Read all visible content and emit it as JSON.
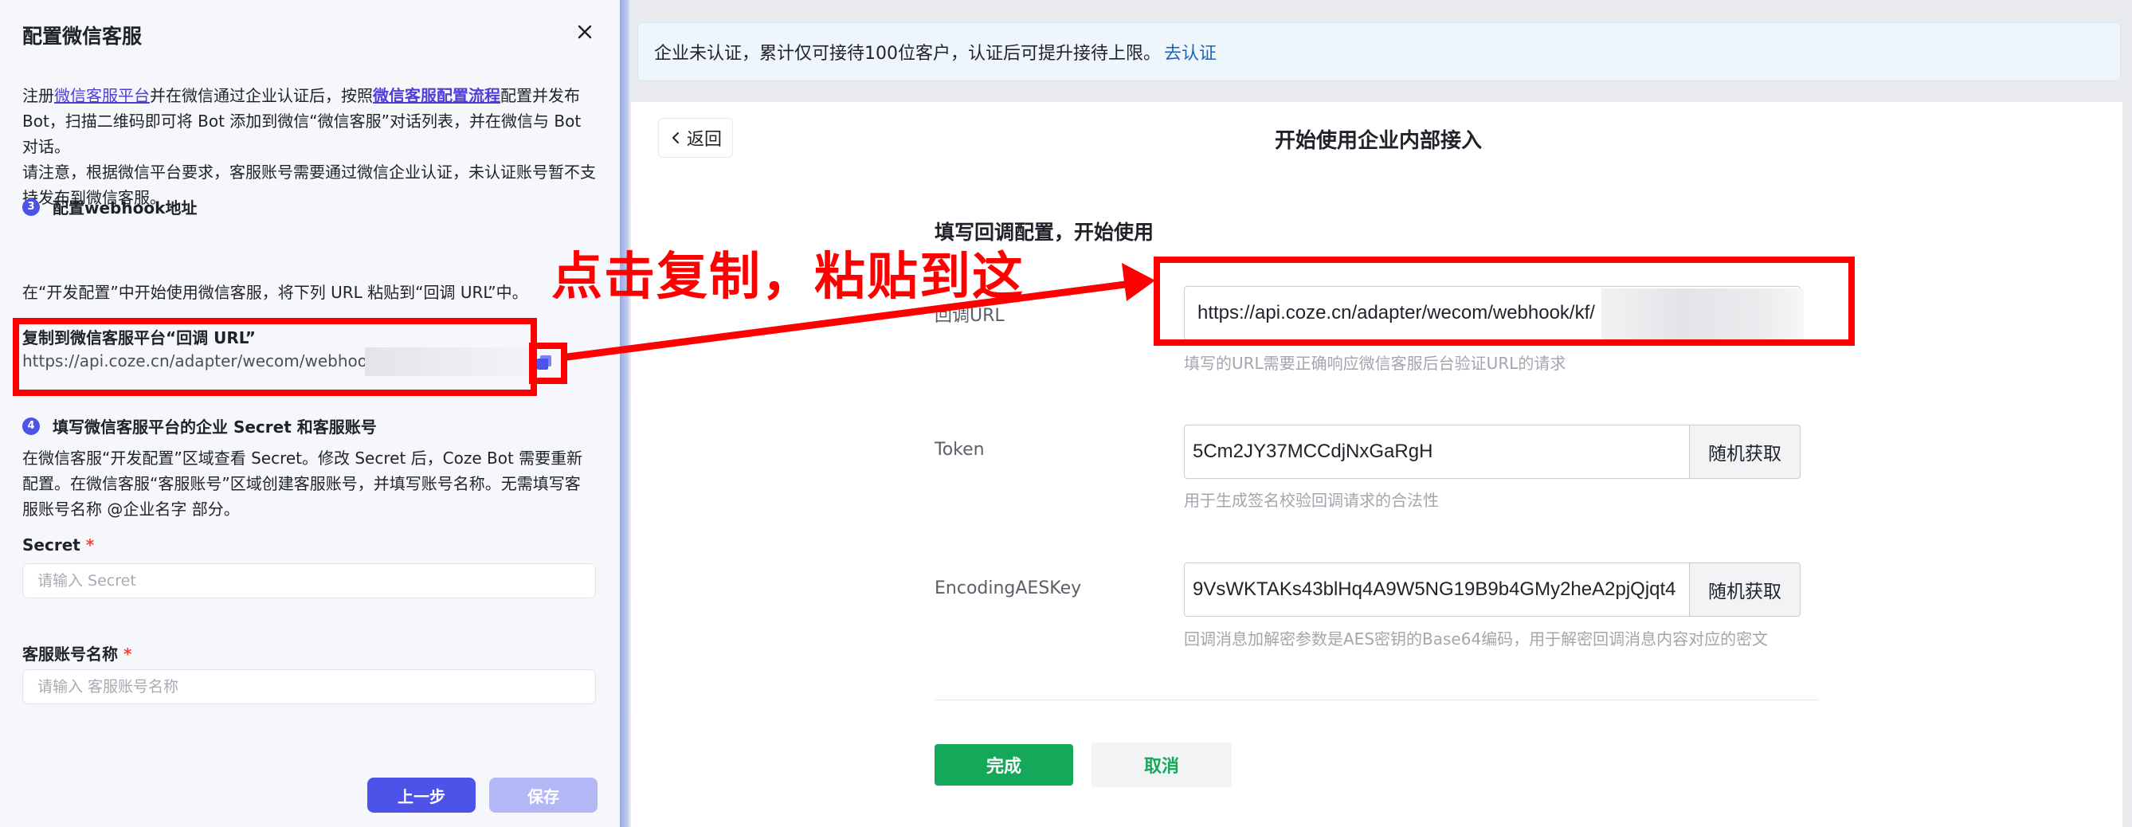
{
  "left_panel": {
    "title": "配置微信客服",
    "intro": {
      "p1_a": "注册",
      "p1_link1": "微信客服平台",
      "p1_b": "并在微信通过企业认证后，按照",
      "p1_link2": "微信客服配置流程",
      "p1_c": "配置并发布 Bot，扫描二维码即可将 Bot 添加到微信“微信客服”对话列表，并在微信与 Bot 对话。",
      "p2": "请注意，根据微信平台要求，客服账号需要通过微信企业认证，未认证账号暂不支持发布到微信客服。"
    },
    "step3": {
      "num": "3",
      "title": "配置webhook地址",
      "desc": "在“开发配置”中开始使用微信客服，将下列 URL 粘贴到“回调 URL”中。"
    },
    "copy": {
      "title": "复制到微信客服平台“回调 URL”",
      "url": "https://api.coze.cn/adapter/wecom/webhook/kf/"
    },
    "step4": {
      "num": "4",
      "title": "填写微信客服平台的企业 Secret 和客服账号",
      "desc": "在微信客服“开发配置”区域查看 Secret。修改 Secret 后，Coze Bot 需要重新配置。在微信客服“客服账号”区域创建客服账号，并填写账号名称。无需填写客服账号名称 @企业名字 部分。"
    },
    "secret": {
      "label": "Secret",
      "required": "*",
      "placeholder": "请输入 Secret"
    },
    "account": {
      "label": "客服账号名称",
      "required": "*",
      "placeholder": "请输入 客服账号名称"
    },
    "buttons": {
      "prev": "上一步",
      "save": "保存"
    }
  },
  "right_panel": {
    "banner": {
      "text": "企业未认证，累计仅可接待100位客户，认证后可提升接待上限。",
      "link": "去认证"
    },
    "back_label": "返回",
    "title": "开始使用企业内部接入",
    "section_title": "填写回调配置，开始使用",
    "url": {
      "label": "回调URL",
      "value": "https://api.coze.cn/adapter/wecom/webhook/kf/",
      "help": "填写的URL需要正确响应微信客服后台验证URL的请求"
    },
    "token": {
      "label": "Token",
      "value": "5Cm2JY37MCCdjNxGaRgH",
      "button": "随机获取",
      "help": "用于生成签名校验回调请求的合法性"
    },
    "aes": {
      "label": "EncodingAESKey",
      "value": "9VsWKTAKs43blHq4A9W5NG19B9b4GMy2heA2pjQjqt4",
      "button": "随机获取",
      "help": "回调消息加解密参数是AES密钥的Base64编码，用于解密回调消息内容对应的密文"
    },
    "buttons": {
      "done": "完成",
      "cancel": "取消"
    }
  },
  "annotation": {
    "text": "点击复制，粘贴到这",
    "color": "#ff0000"
  },
  "colors": {
    "primary": "#4d53e8",
    "wechat_green": "#16a85a",
    "annotation_red": "#ff0000",
    "link": "#1f63b8"
  }
}
